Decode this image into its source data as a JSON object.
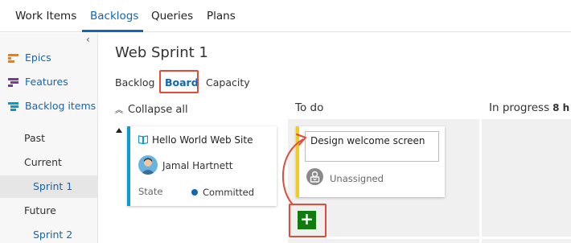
{
  "topnav": {
    "tabs": [
      {
        "label": "Work Items"
      },
      {
        "label": "Backlogs"
      },
      {
        "label": "Queries"
      },
      {
        "label": "Plans"
      }
    ],
    "active_tab": "Backlogs"
  },
  "sidebar": {
    "collapse_glyph": "‹",
    "backlog_levels": [
      {
        "label": "Epics",
        "icon": "epics-icon",
        "color": "#ff7b00"
      },
      {
        "label": "Features",
        "icon": "features-icon",
        "color": "#773b93"
      },
      {
        "label": "Backlog items",
        "icon": "backlog-items-icon",
        "color": "#009ccc"
      }
    ],
    "sprints": {
      "past": "Past",
      "current": "Current",
      "current_sprint": "Sprint 1",
      "future": "Future",
      "future_sprint": "Sprint 2"
    }
  },
  "main": {
    "title": "Web Sprint 1",
    "subtabs": [
      {
        "label": "Backlog"
      },
      {
        "label": "Board"
      },
      {
        "label": "Capacity"
      }
    ],
    "active_subtab": "Board",
    "collapse_all": "Collapse all",
    "columns": {
      "todo": {
        "label": "To do"
      },
      "in_progress": {
        "label": "In progress",
        "capacity": "8 h"
      }
    },
    "parent_card": {
      "title": "Hello World Web Site",
      "assignee": "Jamal Hartnett",
      "state_label": "State",
      "state_value": "Committed"
    },
    "new_card": {
      "title_value": "Design welcome screen",
      "assignee": "Unassigned"
    },
    "add_button_glyph": "+"
  },
  "colors": {
    "accent": "#0f67b5",
    "highlight": "#e44a38",
    "add_button": "#107c10",
    "parent_card_stripe": "#0a9bd2",
    "task_card_stripe": "#f2cb1d"
  }
}
